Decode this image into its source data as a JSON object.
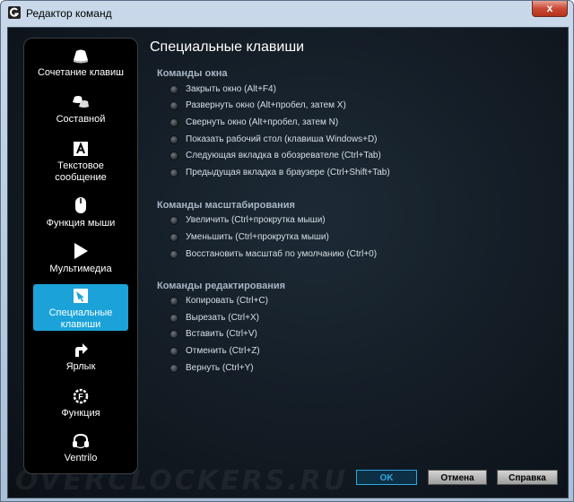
{
  "window": {
    "title": "Редактор команд",
    "close_symbol": "x"
  },
  "sidebar": {
    "items": [
      {
        "label": "Сочетание клавиш",
        "icon": "keys-combo-icon"
      },
      {
        "label": "Составной",
        "icon": "multikey-icon"
      },
      {
        "label": "Текстовое сообщение",
        "icon": "text-block-icon"
      },
      {
        "label": "Функция мыши",
        "icon": "mouse-icon"
      },
      {
        "label": "Мультимедиа",
        "icon": "play-icon"
      },
      {
        "label": "Специальные клавиши",
        "icon": "special-keys-icon",
        "active": true
      },
      {
        "label": "Ярлык",
        "icon": "shortcut-arrow-icon"
      },
      {
        "label": "Функция",
        "icon": "function-icon"
      },
      {
        "label": "Ventrilo",
        "icon": "headset-icon"
      }
    ]
  },
  "main": {
    "heading": "Специальные клавиши",
    "sections": [
      {
        "title": "Команды окна",
        "options": [
          "Закрыть окно (Alt+F4)",
          "Развернуть окно  (Alt+пробел, затем X)",
          "Свернуть окно (Alt+пробел, затем N)",
          "Показать рабочий стол (клавиша Windows+D)",
          "Следующая вкладка в обозревателе (Ctrl+Tab)",
          "Предыдущая вкладка в браузере (Ctrl+Shift+Tab)"
        ]
      },
      {
        "title": "Команды масштабирования",
        "options": [
          "Увеличить  (Ctrl+прокрутка мыши)",
          "Уменьшить (Ctrl+прокрутка мыши)",
          "Восстановить масштаб по умолчанию (Ctrl+0)"
        ]
      },
      {
        "title": "Команды редактирования",
        "options": [
          "Копировать (Ctrl+C)",
          "Вырезать (Ctrl+X)",
          "Вставить (Ctrl+V)",
          "Отменить (Ctrl+Z)",
          "Вернуть (Ctrl+Y)"
        ]
      }
    ]
  },
  "footer": {
    "ok": "OK",
    "cancel": "Отмена",
    "help": "Справка"
  },
  "watermark": "OVERCLOCKERS.RU",
  "colors": {
    "accent": "#1ba3d9",
    "background": "#121a22"
  }
}
